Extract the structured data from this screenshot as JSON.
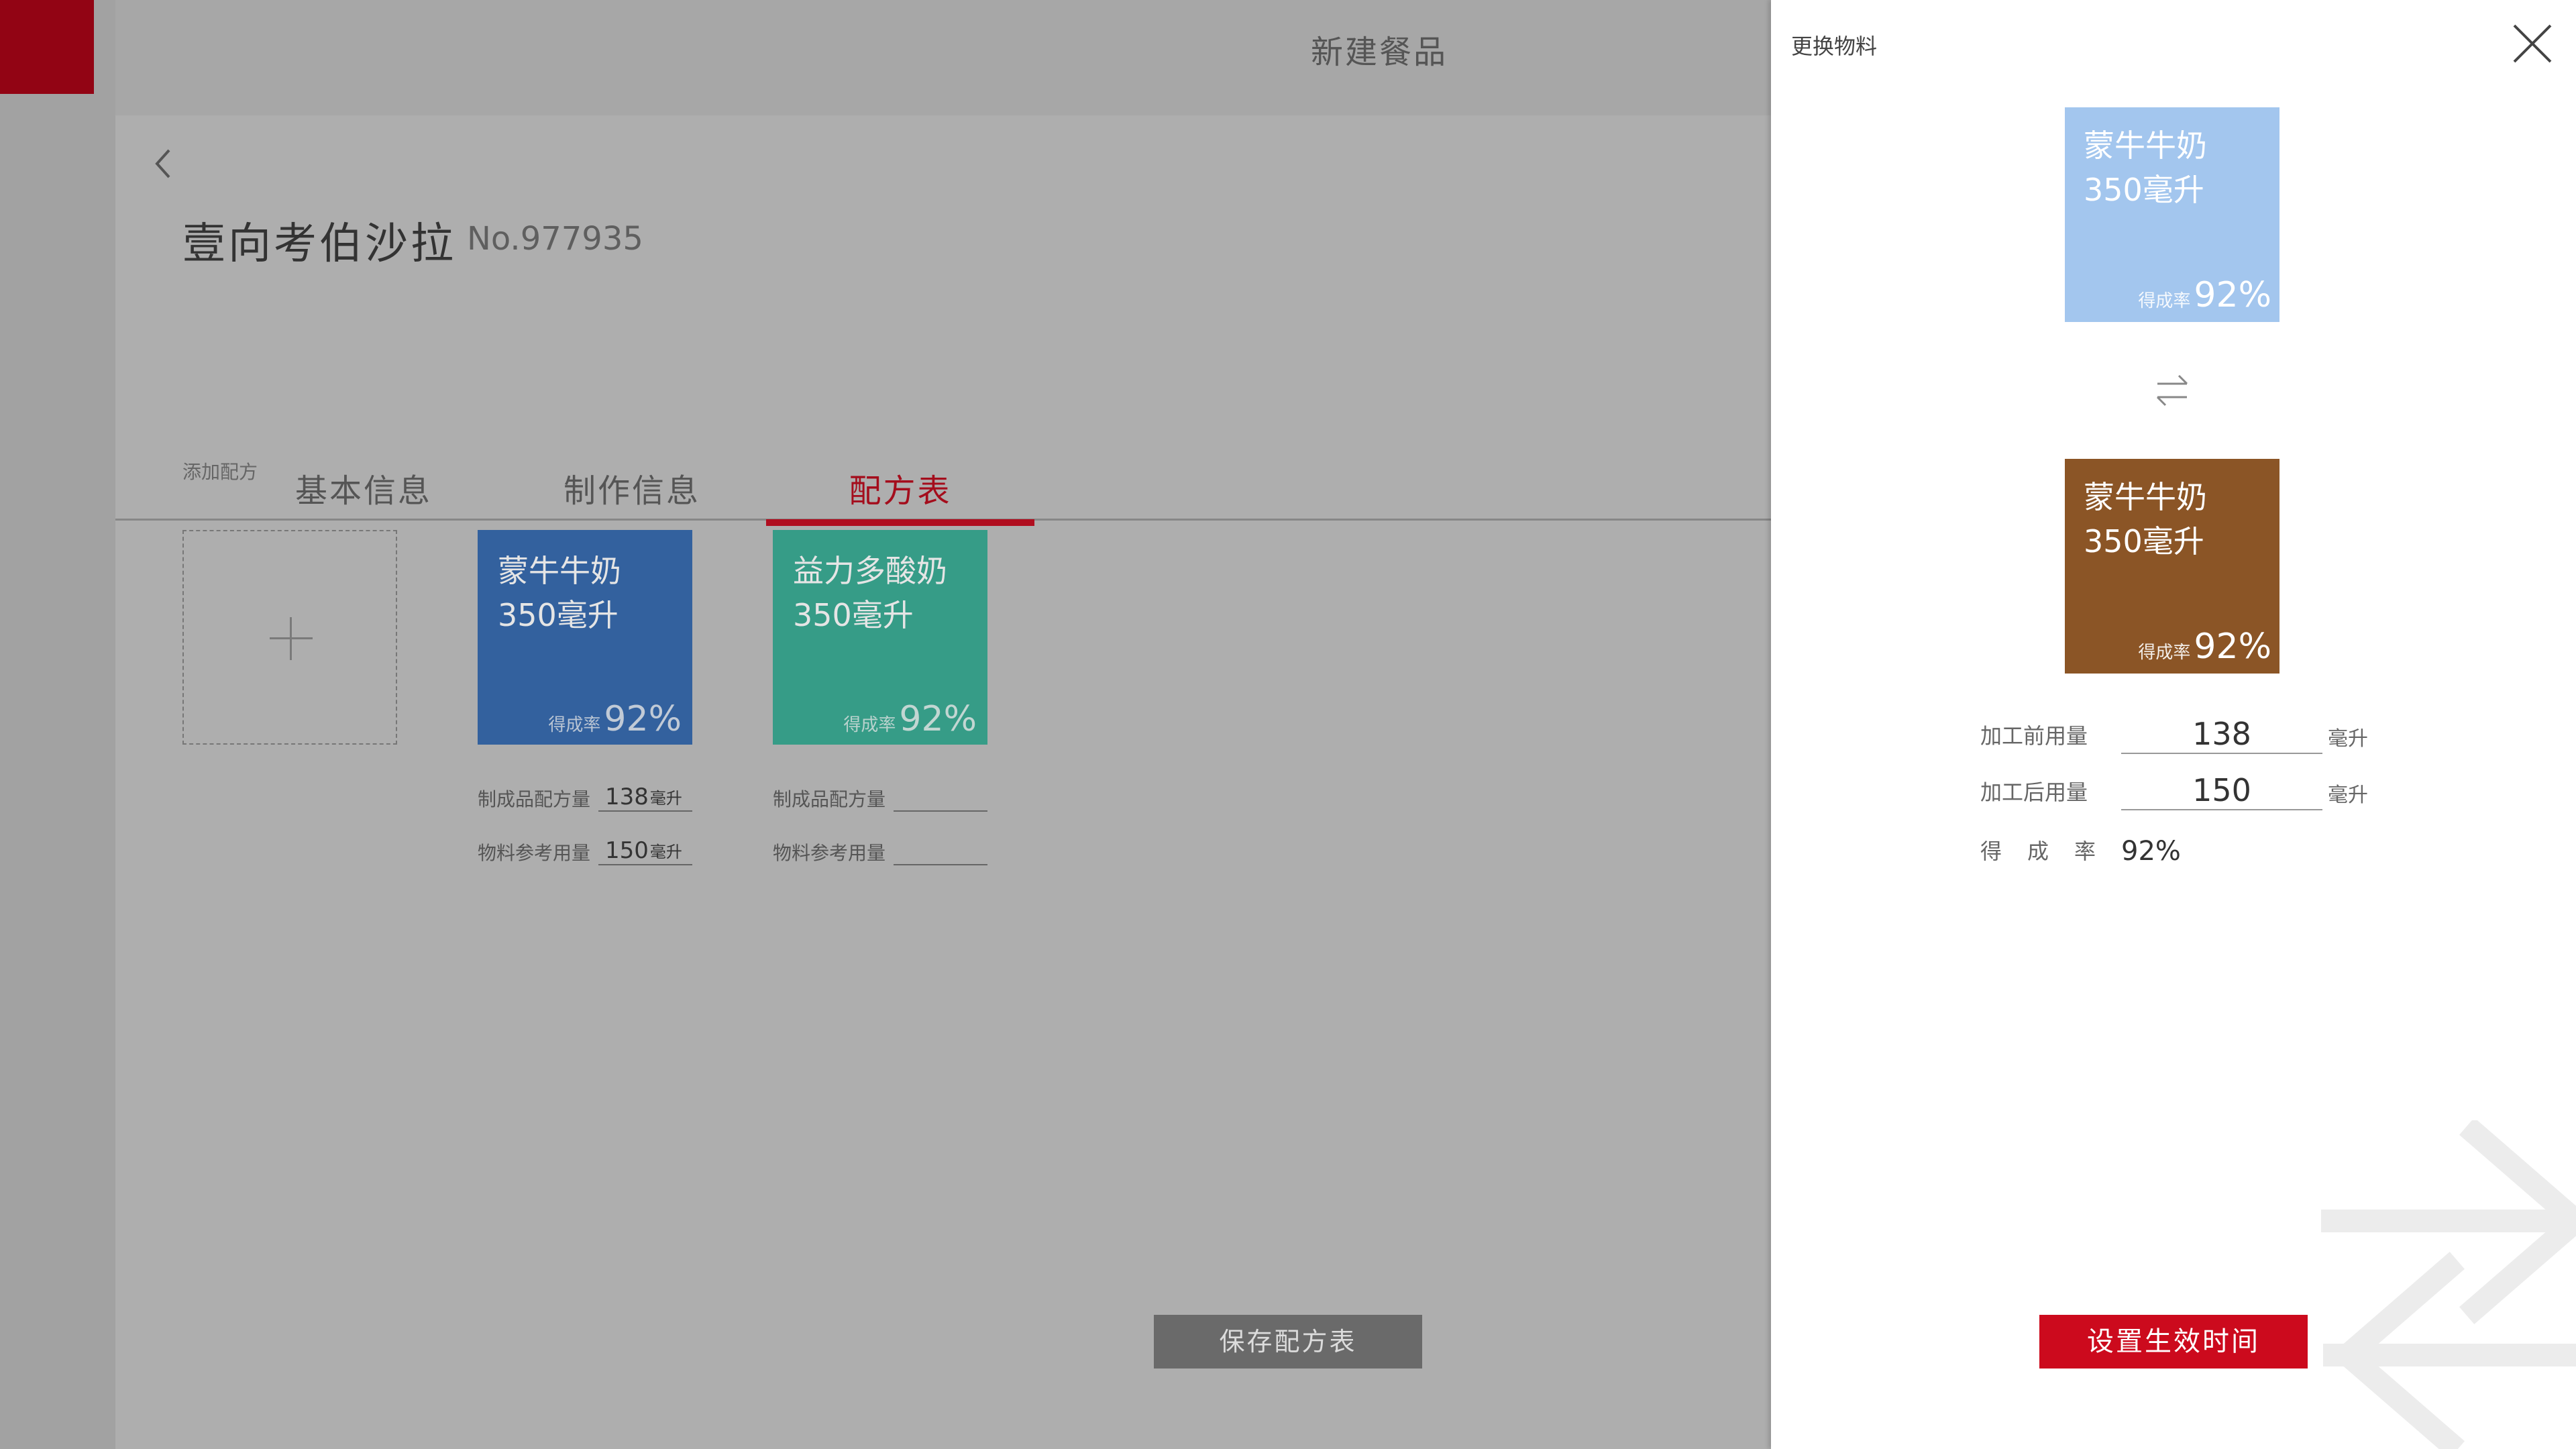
{
  "header": {
    "title": "新建餐品"
  },
  "dish": {
    "name": "壹向考伯沙拉",
    "number": "No.977935"
  },
  "tabs": [
    {
      "label": "基本信息"
    },
    {
      "label": "制作信息"
    },
    {
      "label": "配方表",
      "active": true
    }
  ],
  "section": {
    "label": "添加配方"
  },
  "materials": [
    {
      "name_line1": "蒙牛牛奶",
      "name_line2": "350毫升",
      "rate_label": "得成率",
      "rate_value": "92%",
      "color": "#33619e",
      "fields": [
        {
          "label": "制成品配方量",
          "value": "138",
          "unit": "毫升"
        },
        {
          "label": "物料参考用量",
          "value": "150",
          "unit": "毫升"
        }
      ]
    },
    {
      "name_line1": "益力多酸奶",
      "name_line2": "350毫升",
      "rate_label": "得成率",
      "rate_value": "92%",
      "color": "#369c87",
      "fields": [
        {
          "label": "制成品配方量",
          "value": "",
          "unit": ""
        },
        {
          "label": "物料参考用量",
          "value": "",
          "unit": ""
        }
      ]
    }
  ],
  "save_button": {
    "label": "保存配方表"
  },
  "drawer": {
    "title": "更换物料",
    "current": {
      "name_line1": "蒙牛牛奶",
      "name_line2": "350毫升",
      "rate_label": "得成率",
      "rate_value": "92%",
      "color": "#a3c6ee"
    },
    "replacement": {
      "name_line1": "蒙牛牛奶",
      "name_line2": "350毫升",
      "rate_label": "得成率",
      "rate_value": "92%",
      "color": "#8b5526"
    },
    "fields": {
      "before_label": "加工前用量",
      "before_value": "138",
      "before_unit": "毫升",
      "after_label": "加工后用量",
      "after_value": "150",
      "after_unit": "毫升",
      "rate_label": "得成率",
      "rate_value": "92%"
    },
    "confirm_button": {
      "label": "设置生效时间"
    }
  },
  "colors": {
    "accent": "#cc0a1d",
    "rail_logo": "#920414",
    "overlay": "#a9a9a9"
  }
}
